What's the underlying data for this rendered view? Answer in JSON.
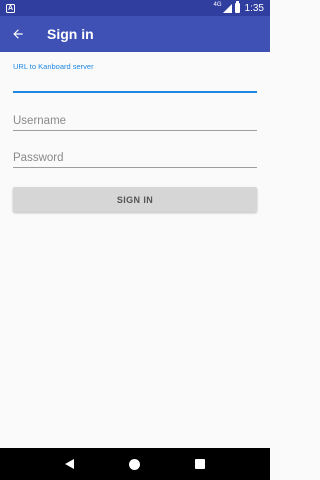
{
  "status_bar": {
    "notification_icon": "A",
    "network_label": "4G",
    "time": "1:35"
  },
  "app_bar": {
    "title": "Sign in",
    "back_icon": "arrow-left-icon"
  },
  "form": {
    "url_field": {
      "label": "URL to Kanboard server",
      "value": ""
    },
    "username_field": {
      "placeholder": "Username",
      "value": ""
    },
    "password_field": {
      "placeholder": "Password",
      "value": ""
    },
    "signin_button": "SIGN IN"
  },
  "colors": {
    "primary": "#3f51b5",
    "primary_dark": "#303f9f",
    "accent": "#1e88e5",
    "button_bg": "#d6d6d6"
  }
}
